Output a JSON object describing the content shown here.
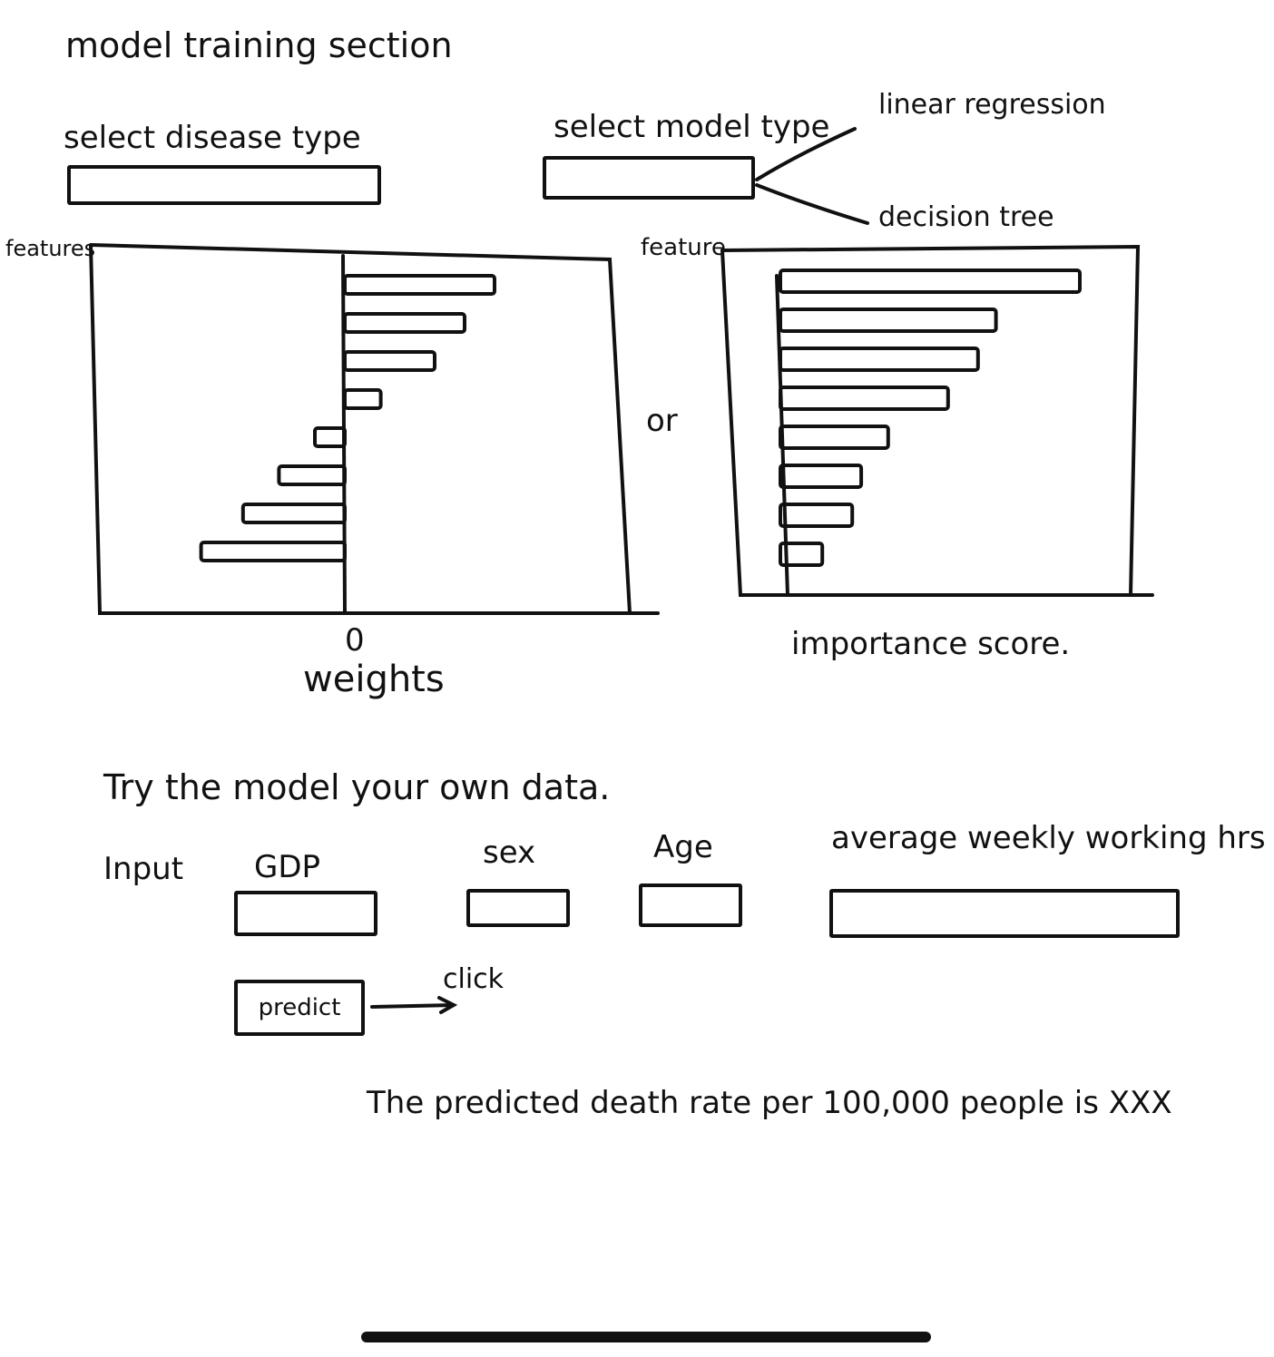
{
  "header": {
    "title": "model training section"
  },
  "disease": {
    "label": "select disease type",
    "value": ""
  },
  "model": {
    "label": "select model type",
    "value": "",
    "options": [
      "linear regression",
      "decision tree"
    ]
  },
  "or_text": "or",
  "weights_chart": {
    "ylabel": "features",
    "xlabel": "weights",
    "zero_tick": "0"
  },
  "importance_chart": {
    "ylabel": "feature",
    "xlabel": "importance score."
  },
  "chart_data": [
    {
      "type": "bar",
      "orientation": "horizontal",
      "ylabel": "features",
      "xlabel": "weights",
      "xticks": [
        "0"
      ],
      "values": [
        2.5,
        2.0,
        1.5,
        0.6,
        -0.5,
        -1.1,
        -1.7,
        -2.4
      ]
    },
    {
      "type": "bar",
      "orientation": "horizontal",
      "ylabel": "feature",
      "xlabel": "importance score.",
      "values": [
        10,
        7.2,
        6.6,
        5.6,
        3.6,
        2.7,
        2.4,
        1.4
      ]
    }
  ],
  "try_section": {
    "heading": "Try the model your own data.",
    "input_label": "Input",
    "fields": [
      {
        "label": "GDP",
        "value": ""
      },
      {
        "label": "sex",
        "value": ""
      },
      {
        "label": "Age",
        "value": ""
      },
      {
        "label": "average weekly working hrs",
        "value": ""
      }
    ],
    "predict_label": "predict",
    "click_note": "click",
    "result_text": "The predicted death rate per 100,000 people is XXX"
  }
}
